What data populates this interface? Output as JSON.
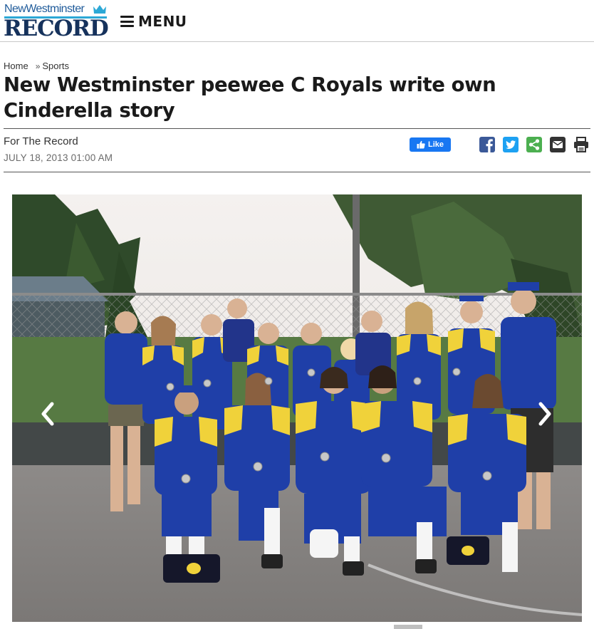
{
  "header": {
    "logo_top": "NewWestminster",
    "logo_main": "RECORD",
    "menu_label": "MENU"
  },
  "breadcrumb": {
    "home": "Home",
    "separator": "»",
    "section": "Sports"
  },
  "article": {
    "title": "New Westminster peewee C Royals write own Cinderella story",
    "byline": "For The Record",
    "date": "JULY 18, 2013 01:00 AM"
  },
  "social": {
    "like_label": "Like",
    "icons": [
      "facebook-icon",
      "twitter-icon",
      "share-icon",
      "email-icon",
      "print-icon"
    ]
  },
  "gallery": {
    "prev_icon": "chevron-left-icon",
    "next_icon": "chevron-right-icon"
  },
  "colors": {
    "logo_blue": "#16325c",
    "logo_accent": "#2ca8d6",
    "facebook": "#3b5998",
    "like_button": "#1877f2",
    "twitter": "#1da1f2",
    "share": "#4caf50",
    "email": "#333333",
    "print": "#333333"
  }
}
